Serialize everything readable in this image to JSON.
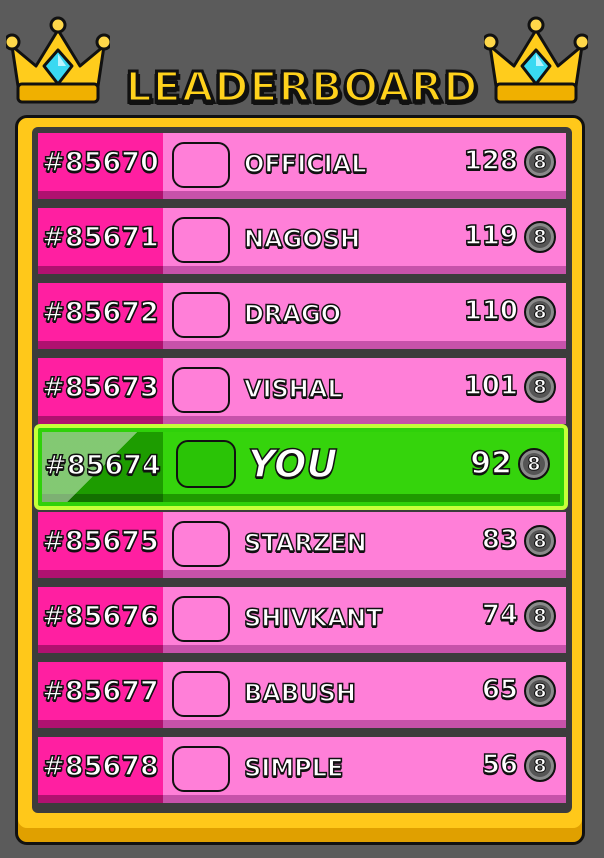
{
  "header": {
    "title": "LEADERBOARD",
    "left_icon": "crown-icon",
    "right_icon": "crown-icon"
  },
  "colors": {
    "frame": "#ffc81a",
    "rank_bg": "#ff1fa1",
    "row_bg": "#ff7fd8",
    "you_bg": "#35d40c",
    "you_border": "#c6ff3a"
  },
  "rows": [
    {
      "rank": "#85670",
      "name": "OFFICIAL",
      "score": "128",
      "coin_icon": "8-ball-coin-icon",
      "coin_label": "8"
    },
    {
      "rank": "#85671",
      "name": "NAGOSH",
      "score": "119",
      "coin_icon": "8-ball-coin-icon",
      "coin_label": "8"
    },
    {
      "rank": "#85672",
      "name": "DRAGO",
      "score": "110",
      "coin_icon": "8-ball-coin-icon",
      "coin_label": "8"
    },
    {
      "rank": "#85673",
      "name": "VISHAL",
      "score": "101",
      "coin_icon": "8-ball-coin-icon",
      "coin_label": "8"
    },
    {
      "rank": "#85674",
      "name": "YOU",
      "score": "92",
      "coin_icon": "8-ball-coin-icon",
      "coin_label": "8",
      "is_you": true
    },
    {
      "rank": "#85675",
      "name": "STARZEN",
      "score": "83",
      "coin_icon": "8-ball-coin-icon",
      "coin_label": "8"
    },
    {
      "rank": "#85676",
      "name": "SHIVKANT",
      "score": "74",
      "coin_icon": "8-ball-coin-icon",
      "coin_label": "8"
    },
    {
      "rank": "#85677",
      "name": "BABUSH",
      "score": "65",
      "coin_icon": "8-ball-coin-icon",
      "coin_label": "8"
    },
    {
      "rank": "#85678",
      "name": "SIMPLE",
      "score": "56",
      "coin_icon": "8-ball-coin-icon",
      "coin_label": "8"
    }
  ]
}
